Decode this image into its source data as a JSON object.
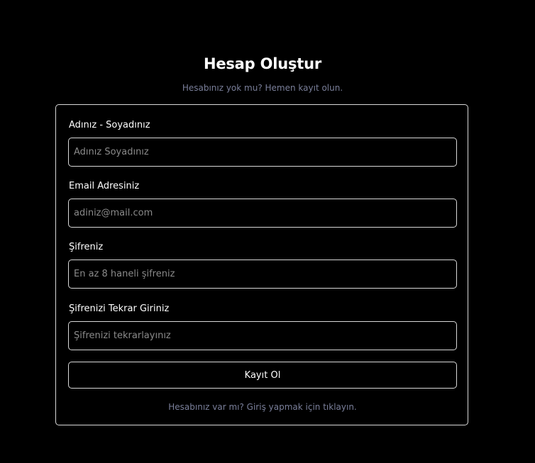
{
  "header": {
    "title": "Hesap Oluştur",
    "subtitle": "Hesabınız yok mu? Hemen kayıt olun."
  },
  "form": {
    "fields": [
      {
        "label": "Adınız - Soyadınız",
        "placeholder": "Adınız Soyadınız",
        "value": ""
      },
      {
        "label": "Email Adresiniz",
        "placeholder": "adiniz@mail.com",
        "value": ""
      },
      {
        "label": "Şifreniz",
        "placeholder": "En az 8 haneli şifreniz",
        "value": ""
      },
      {
        "label": "Şifrenizi Tekrar Giriniz",
        "placeholder": "Şifrenizi tekrarlayınız",
        "value": ""
      }
    ],
    "submit_label": "Kayıt Ol",
    "login_link": "Hesabınız var mı? Giriş yapmak için tıklayın."
  },
  "colors": {
    "background": "#000000",
    "text": "#ffffff",
    "muted_text": "#7a7f9a",
    "border": "#d8d8d8"
  }
}
